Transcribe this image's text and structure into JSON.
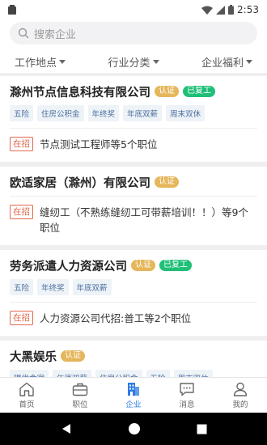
{
  "status": {
    "time": "2:53"
  },
  "search": {
    "placeholder": "搜索企业"
  },
  "filters": [
    {
      "label": "工作地点"
    },
    {
      "label": "行业分类"
    },
    {
      "label": "企业福利"
    }
  ],
  "companies": [
    {
      "name": "滁州节点信息科技有限公司",
      "cert": "认证",
      "back": "已复工",
      "tags": [
        "五险",
        "住房公积金",
        "年终奖",
        "年底双薪",
        "周末双休"
      ],
      "hiring": "在招",
      "job": "节点测试工程师等5个职位"
    },
    {
      "name": "欧适家居（滁州）有限公司",
      "cert": "认证",
      "hiring": "在招",
      "job": "缝纫工（不熟练缝纫工可带薪培训！！）等9个职位"
    },
    {
      "name": "劳务派遣人力资源公司",
      "cert": "认证",
      "back": "已复工",
      "tags": [
        "五险",
        "年终奖",
        "年底双薪"
      ],
      "hiring": "在招",
      "job": "人力资源公司代招:普工等2个职位"
    },
    {
      "name": "大黑娱乐",
      "cert": "认证",
      "tags": [
        "提供食宿",
        "年底双薪",
        "住房公积金",
        "五险",
        "周末双休"
      ]
    }
  ],
  "tabs": [
    {
      "label": "首页",
      "icon": "home-icon"
    },
    {
      "label": "职位",
      "icon": "briefcase-icon"
    },
    {
      "label": "企业",
      "icon": "building-icon",
      "active": true
    },
    {
      "label": "消息",
      "icon": "message-icon"
    },
    {
      "label": "我的",
      "icon": "user-icon"
    }
  ],
  "colors": {
    "accent": "#2f7be0",
    "cert": "#e5b65a",
    "back": "#1fbf77",
    "hiring": "#e0684a",
    "tag_text": "#4a6f9e"
  }
}
